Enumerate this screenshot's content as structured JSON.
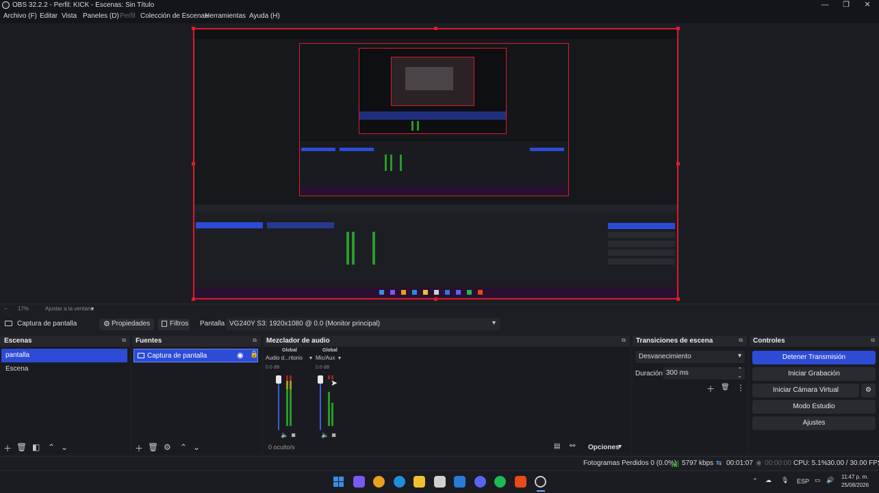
{
  "window": {
    "title": "OBS 32.2.2 - Perfil: KICK - Escenas: Sin Título",
    "controls": [
      "—",
      "❐",
      "✕"
    ]
  },
  "menu": [
    {
      "label": "Archivo (F)",
      "enabled": true
    },
    {
      "label": "Editar",
      "enabled": true
    },
    {
      "label": "Vista",
      "enabled": true
    },
    {
      "label": "Paneles (D)",
      "enabled": true
    },
    {
      "label": "Perfil",
      "enabled": false
    },
    {
      "label": "Colección de Escenas",
      "enabled": true
    },
    {
      "label": "Herramientas",
      "enabled": true
    },
    {
      "label": "Ayuda (H)",
      "enabled": true
    }
  ],
  "colors": {
    "accent": "#2e4bd6",
    "preview_border": "#e01a2c",
    "background": "#1d1e24",
    "panel": "#1a1b20",
    "panel_header": "#26272d"
  },
  "zoom": {
    "level": "17%",
    "fit_label": "Ajustar a la ventana"
  },
  "source_toolbar": {
    "source_name": "Captura de pantalla",
    "properties_label": "Propiedades",
    "filters_label": "Filtros",
    "display_label": "Pantalla",
    "display_value": "VG240Y S3: 1920x1080 @ 0.0 (Monitor principal)",
    "icons": [
      "monitor-icon",
      "gear-icon",
      "filter-icon",
      "chevron-down-icon"
    ]
  },
  "scenes": {
    "title": "Escenas",
    "items": [
      {
        "label": "pantalla",
        "selected": true
      },
      {
        "label": "Escena",
        "selected": false
      }
    ]
  },
  "sources": {
    "title": "Fuentes",
    "items": [
      {
        "label": "Captura de pantalla",
        "selected": true,
        "visible": true,
        "locked": true
      }
    ]
  },
  "mixer": {
    "title": "Mezclador de audio",
    "channels": [
      {
        "group": "Global",
        "name": "Audio d...ritorio",
        "level": "0.0 dB"
      },
      {
        "group": "Global",
        "name": "Mic/Aux",
        "level": "0.0 dB"
      }
    ],
    "hidden_count": "0 oculto/s",
    "options_label": "Opciones"
  },
  "transitions": {
    "title": "Transiciones de escena",
    "selected": "Desvanecimiento",
    "duration_label": "Duración",
    "duration_value": "300 ms"
  },
  "controls": {
    "title": "Controles",
    "buttons": [
      {
        "label": "Detener Transmisión",
        "primary": true
      },
      {
        "label": "Iniciar Grabación",
        "primary": false
      },
      {
        "label": "Iniciar Cámara Virtual",
        "primary": false
      },
      {
        "label": "Modo Estudio",
        "primary": false
      },
      {
        "label": "Ajustes",
        "primary": false
      }
    ]
  },
  "status": {
    "dropped_frames": "Fotogramas Perdidos 0 (0.0%)",
    "bitrate": "5797 kbps",
    "stream_time": "00:01:07",
    "record_time": "00:00:00",
    "cpu": "CPU: 5.1%",
    "fps": "30.00 / 30.00 FPS"
  },
  "taskbar": {
    "apps": [
      {
        "icon": "windows-start-icon",
        "color": "#3a8ee6"
      },
      {
        "icon": "copilot-icon",
        "color": "#7a5af0"
      },
      {
        "icon": "chrome-icon",
        "color": "#e8a020"
      },
      {
        "icon": "edge-icon",
        "color": "#1e90d8"
      },
      {
        "icon": "file-explorer-icon",
        "color": "#f0c030"
      },
      {
        "icon": "calendar-icon",
        "color": "#d0d0d0"
      },
      {
        "icon": "outlook-icon",
        "color": "#2a7ad8"
      },
      {
        "icon": "discord-icon",
        "color": "#5865f2"
      },
      {
        "icon": "spotify-icon",
        "color": "#1db954"
      },
      {
        "icon": "brave-icon",
        "color": "#e84a1a"
      },
      {
        "icon": "obs-icon",
        "color": "#cccccc"
      }
    ],
    "language": "ESP",
    "time": "11:47 p. m.",
    "date": "25/08/2026"
  }
}
